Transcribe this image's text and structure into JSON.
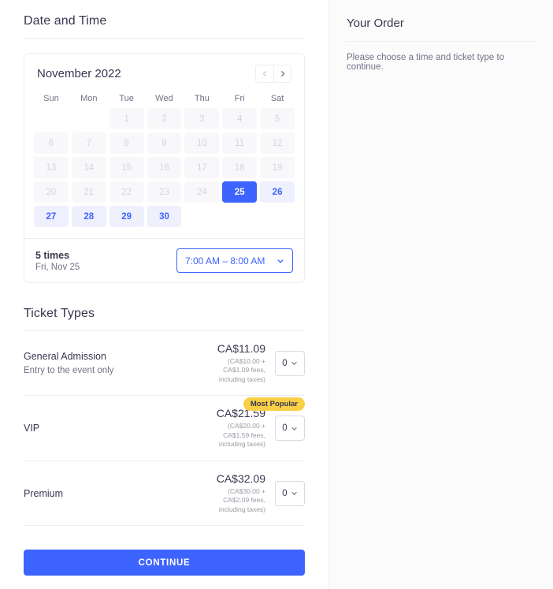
{
  "left": {
    "date_time_heading": "Date and Time",
    "calendar": {
      "month_label": "November 2022",
      "prev_icon": "chevron-left-icon",
      "next_icon": "chevron-right-icon",
      "weekdays": [
        "Sun",
        "Mon",
        "Tue",
        "Wed",
        "Thu",
        "Fri",
        "Sat"
      ],
      "weeks": [
        [
          {
            "label": "",
            "state": "empty"
          },
          {
            "label": "",
            "state": "empty"
          },
          {
            "label": "1",
            "state": "disabled"
          },
          {
            "label": "2",
            "state": "disabled"
          },
          {
            "label": "3",
            "state": "disabled"
          },
          {
            "label": "4",
            "state": "disabled"
          },
          {
            "label": "5",
            "state": "disabled"
          }
        ],
        [
          {
            "label": "6",
            "state": "disabled"
          },
          {
            "label": "7",
            "state": "disabled"
          },
          {
            "label": "8",
            "state": "disabled"
          },
          {
            "label": "9",
            "state": "disabled"
          },
          {
            "label": "10",
            "state": "disabled"
          },
          {
            "label": "11",
            "state": "disabled"
          },
          {
            "label": "12",
            "state": "disabled"
          }
        ],
        [
          {
            "label": "13",
            "state": "disabled"
          },
          {
            "label": "14",
            "state": "disabled"
          },
          {
            "label": "15",
            "state": "disabled"
          },
          {
            "label": "16",
            "state": "disabled"
          },
          {
            "label": "17",
            "state": "disabled"
          },
          {
            "label": "18",
            "state": "disabled"
          },
          {
            "label": "19",
            "state": "disabled"
          }
        ],
        [
          {
            "label": "20",
            "state": "disabled"
          },
          {
            "label": "21",
            "state": "disabled"
          },
          {
            "label": "22",
            "state": "disabled"
          },
          {
            "label": "23",
            "state": "disabled"
          },
          {
            "label": "24",
            "state": "disabled"
          },
          {
            "label": "25",
            "state": "selected"
          },
          {
            "label": "26",
            "state": "avail"
          }
        ],
        [
          {
            "label": "27",
            "state": "avail"
          },
          {
            "label": "28",
            "state": "avail"
          },
          {
            "label": "29",
            "state": "avail"
          },
          {
            "label": "30",
            "state": "avail"
          },
          {
            "label": "",
            "state": "empty"
          },
          {
            "label": "",
            "state": "empty"
          },
          {
            "label": "",
            "state": "empty"
          }
        ]
      ]
    },
    "time_bar": {
      "times_count": "5 times",
      "times_date": "Fri, Nov 25",
      "selected_time": "7:00 AM – 8:00 AM",
      "chevron_icon": "chevron-down-icon"
    },
    "ticket_types_heading": "Ticket Types",
    "tickets": [
      {
        "name": "General Admission",
        "description": "Entry to the event only",
        "price": "CA$11.09",
        "fees": "(CA$10.00 + CA$1.09 fees, including taxes)",
        "quantity": "0",
        "badge": ""
      },
      {
        "name": "VIP",
        "description": "",
        "price": "CA$21.59",
        "fees": "(CA$20.00 + CA$1.59 fees, including taxes)",
        "quantity": "0",
        "badge": "Most Popular"
      },
      {
        "name": "Premium",
        "description": "",
        "price": "CA$32.09",
        "fees": "(CA$30.00 + CA$2.09 fees, including taxes)",
        "quantity": "0",
        "badge": ""
      }
    ],
    "continue_label": "CONTINUE"
  },
  "right": {
    "order_heading": "Your Order",
    "order_message": "Please choose a time and ticket type to continue."
  },
  "colors": {
    "accent": "#3d64ff",
    "accent_soft": "#eef0fd",
    "badge": "#f8cf45",
    "text": "#39364f",
    "muted": "#6f7287",
    "disabled_bg": "#f8f7fa",
    "disabled_text": "#d6d5de",
    "border": "#eeedf2",
    "panel_bg": "#fbfbfc"
  }
}
